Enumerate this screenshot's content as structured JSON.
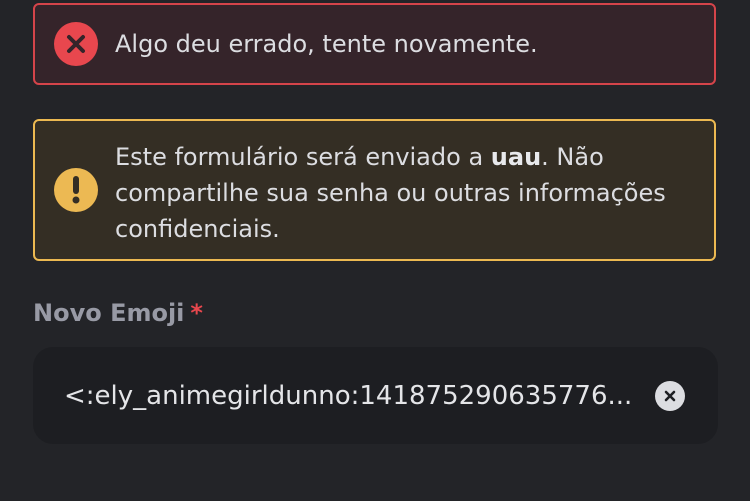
{
  "error_alert": {
    "icon": "close-circle-icon",
    "message": "Algo deu errado, tente novamente.",
    "color": "#e8474e"
  },
  "warning_alert": {
    "icon": "exclamation-circle-icon",
    "text_before": "Este formulário será enviado a ",
    "app_name": "uau",
    "text_after": ". Não compartilhe sua senha ou outras informações confidenciais.",
    "color": "#ecb953"
  },
  "emoji_field": {
    "label": "Novo Emoji",
    "required_marker": "*",
    "value": "<:ely_animegirldunno:141875290635776...",
    "clear_icon": "clear-circle-icon"
  }
}
